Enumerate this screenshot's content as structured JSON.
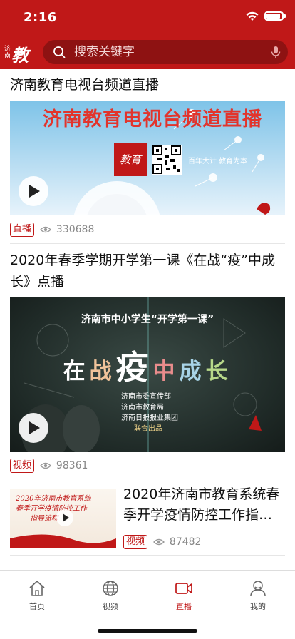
{
  "status": {
    "time": "2:16"
  },
  "header": {
    "logo_small": "济南",
    "logo_big": "教育",
    "search": {
      "placeholder": "搜索关键字",
      "value": ""
    }
  },
  "feed": [
    {
      "title": "济南教育电视台频道直播",
      "thumb_banner": "济南教育电视台频道直播",
      "thumb_logo": "教育",
      "thumb_slogan": "百年大计 教育为本",
      "badge": "直播",
      "views": "330688"
    },
    {
      "title": "2020年春季学期开学第一课《在战“疫”中成长》点播",
      "thumb_heading": "济南市中小学生“开学第一课”",
      "thumb_words": [
        "在",
        "战",
        "疫",
        "中",
        "成",
        "长"
      ],
      "thumb_credits": [
        "济南市委宣传部",
        "济南市教育局",
        "济南日报报业集团",
        "联合出品"
      ],
      "badge": "视频",
      "views": "98361"
    },
    {
      "title": "2020年济南市教育系统春季开学疫情防控工作指…",
      "thumb_lines": [
        "2020年济南市教育系统",
        "春季开学疫情防控工作",
        "指导流程"
      ],
      "badge": "视频",
      "views": "87482"
    }
  ],
  "tabbar": {
    "tabs": [
      {
        "label": "首页",
        "icon": "home-icon",
        "active": false
      },
      {
        "label": "视频",
        "icon": "globe-icon",
        "active": false
      },
      {
        "label": "直播",
        "icon": "camera-icon",
        "active": true
      },
      {
        "label": "我的",
        "icon": "user-icon",
        "active": false
      }
    ]
  },
  "colors": {
    "brand": "#c01818",
    "muted": "#888888"
  }
}
